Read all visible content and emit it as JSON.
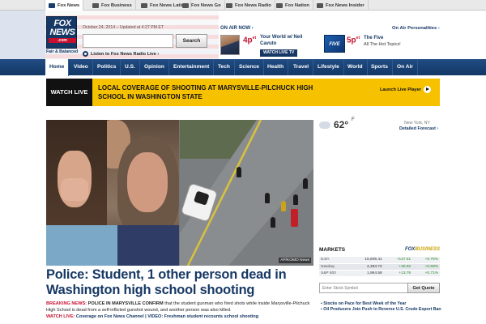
{
  "site_tabs": [
    {
      "label": "Fox News",
      "active": true
    },
    {
      "label": "Fox Business",
      "active": false
    },
    {
      "label": "Fox News Latino",
      "active": false
    },
    {
      "label": "Fox News Go",
      "active": false
    },
    {
      "label": "Fox News Radio",
      "active": false
    },
    {
      "label": "Fox Nation",
      "active": false
    },
    {
      "label": "Fox News Insider",
      "active": false
    }
  ],
  "header": {
    "logo_fox": "FOX",
    "logo_news": "NEWS",
    "logo_com": ".com",
    "tagline": "Fair & Balanced",
    "date": "October 24, 2014 – Updated at 4:27 PM ET",
    "search_placeholder": "",
    "search_label": "Search",
    "radio_label": "Listen to Fox News Radio Live ›"
  },
  "on_air": {
    "label": "ON AIR NOW",
    "arrow": "›",
    "personalities_label": "On Air Personalities",
    "show1": {
      "time": "4p",
      "suffix": "et",
      "title": "Your World w/ Neil Cavuto",
      "watch": "WATCH LIVE TV"
    },
    "show2": {
      "logo": "FIVE",
      "time": "5p",
      "suffix": "et",
      "title": "The Five",
      "sub": "All The Hot Topics!"
    }
  },
  "nav": [
    "Home",
    "Video",
    "Politics",
    "U.S.",
    "Opinion",
    "Entertainment",
    "Tech",
    "Science",
    "Health",
    "Travel",
    "Lifestyle",
    "World",
    "Sports",
    "On Air"
  ],
  "watch_live": {
    "label": "WATCH LIVE",
    "headline": "LOCAL COVERAGE OF SHOOTING AT MARYSVILLE-PILCHUCK HIGH SCHOOL IN WASHINGTON STATE",
    "launch": "Launch Live Player"
  },
  "story": {
    "photo_credit": "AP/KOMO News",
    "title": "Police: Student, 1 other person dead in Washington high school shooting",
    "breaking": "BREAKING NEWS:",
    "caps": "POLICE IN MARYSVILLE CONFIRM",
    "body": " that the student gunman who fired shots while inside Marysville-Pilchuck High School is dead from a self-inflicted gunshot wound, and another person was also killed.",
    "links_label": "WATCH LIVE:",
    "links_text": " Coverage on Fox News Channel | VIDEO: Freshman student recounts school shooting"
  },
  "weather": {
    "temp": "62°",
    "unit": "F",
    "city": "New York, NY",
    "forecast": "Detailed Forecast",
    "arrow": "›"
  },
  "markets": {
    "title": "MARKETS",
    "brand_a": "FOX",
    "brand_b": "BUSINESS",
    "rows": [
      {
        "name": "DJIA",
        "value": "16,805.41",
        "change": "+127.51",
        "pct": "+0.76%"
      },
      {
        "name": "Nasdaq",
        "value": "4,483.72",
        "change": "+30.92",
        "pct": "+0.69%"
      },
      {
        "name": "S&P 500",
        "value": "1,964.58",
        "change": "+13.76",
        "pct": "+0.71%"
      }
    ],
    "stock_placeholder": "Enter Stock Symbol",
    "quote_label": "Get Quote",
    "news": [
      "Stocks on Pace for Best Week of the Year",
      "Oil Producers Join Push to Reverse U.S. Crude Export Ban"
    ]
  }
}
